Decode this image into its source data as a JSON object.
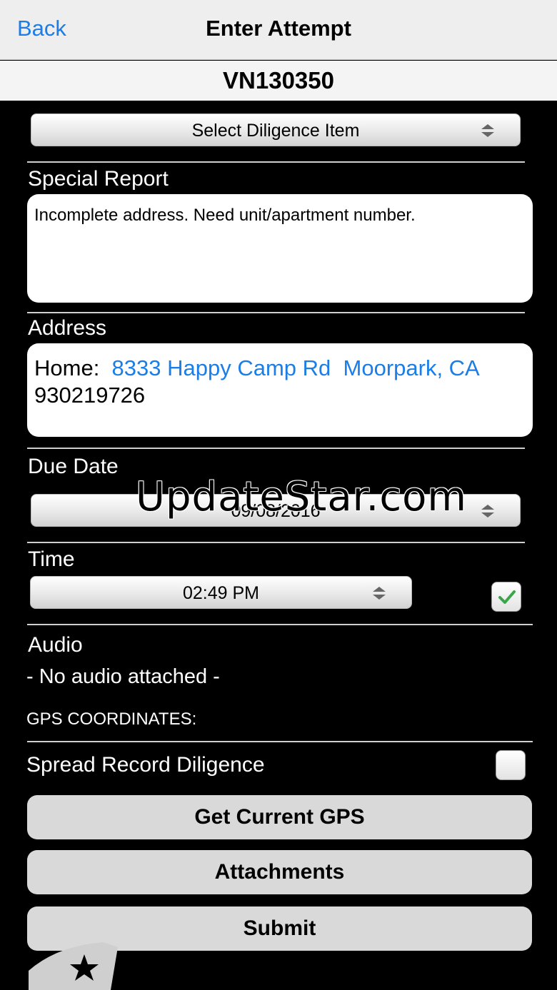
{
  "navbar": {
    "back_label": "Back",
    "title": "Enter Attempt"
  },
  "record_id": "VN130350",
  "diligence_picker": {
    "value": "Select Diligence Item"
  },
  "special_report": {
    "label": "Special Report",
    "text": "Incomplete address. Need unit/apartment number."
  },
  "address": {
    "label": "Address",
    "prefix": "Home:",
    "street": "8333 Happy Camp Rd",
    "city": "Moorpark, CA",
    "zip": "930219726"
  },
  "due_date": {
    "label": "Due Date",
    "value": "09/08/2016"
  },
  "time": {
    "label": "Time",
    "value": "02:49 PM",
    "checked": true
  },
  "audio": {
    "label": "Audio",
    "status": "- No audio attached -"
  },
  "gps": {
    "label": "GPS COORDINATES:"
  },
  "spread_record": {
    "label": "Spread Record Diligence",
    "checked": false
  },
  "buttons": {
    "gps": "Get Current GPS",
    "attachments": "Attachments",
    "submit": "Submit"
  },
  "watermark": "UpdateStar.com",
  "colors": {
    "link": "#1a7ee6",
    "check": "#3aa64a"
  }
}
